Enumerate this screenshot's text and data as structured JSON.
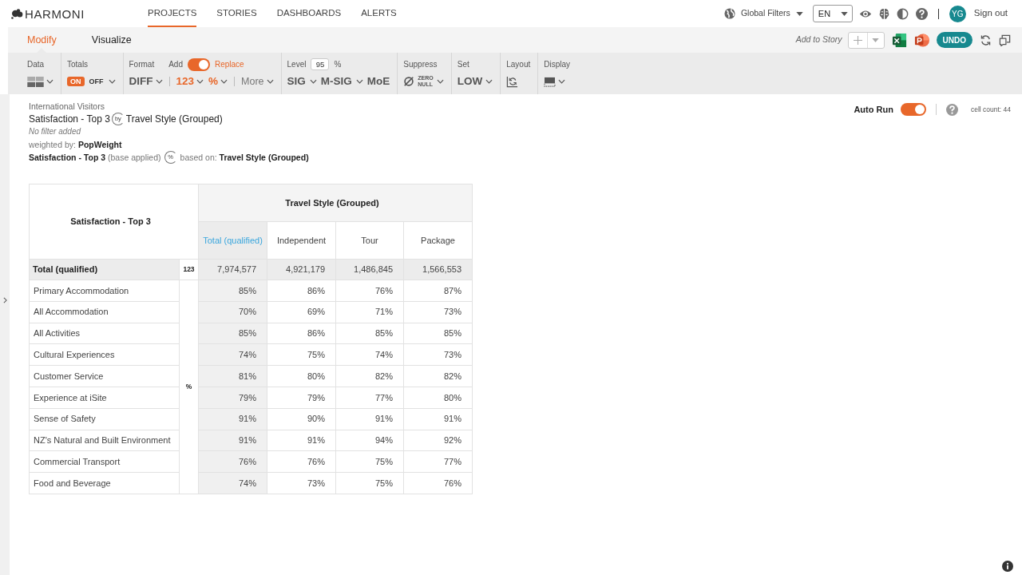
{
  "header": {
    "logo": "HARMONI",
    "nav": [
      {
        "label": "PROJECTS",
        "selected": true
      },
      {
        "label": "STORIES",
        "selected": false
      },
      {
        "label": "DASHBOARDS",
        "selected": false
      },
      {
        "label": "ALERTS",
        "selected": false
      }
    ],
    "global_filters": "Global Filters",
    "language": "EN",
    "avatar": "YG",
    "sign_out": "Sign out"
  },
  "subbar": {
    "tabs": [
      {
        "label": "Modify",
        "selected": true
      },
      {
        "label": "Visualize",
        "selected": false
      }
    ],
    "add_to_story": "Add to Story",
    "undo": "UNDO"
  },
  "toolbar": [
    {
      "kind": "data",
      "label": "Data"
    },
    {
      "kind": "totals",
      "label": "Totals",
      "options": [
        {
          "label": "ON",
          "selected": true
        },
        {
          "label": "OFF",
          "selected": false
        }
      ]
    },
    {
      "kind": "format",
      "label": "Format",
      "switch": {
        "off_label": "Add",
        "on_label": "Replace",
        "on": true
      },
      "sections": [
        [
          {
            "kind": "option",
            "label": "DIFF",
            "active": false
          }
        ],
        [
          {
            "kind": "option",
            "label": "123",
            "active": true
          },
          {
            "kind": "option",
            "label": "%",
            "active": true
          }
        ],
        [
          {
            "kind": "more",
            "label": "More",
            "active": false
          }
        ]
      ]
    },
    {
      "kind": "level",
      "label": "Level",
      "value": "95",
      "unit": "%",
      "items": [
        {
          "kind": "menu",
          "label": "SIG"
        },
        {
          "kind": "menu",
          "label": "M-SIG"
        },
        {
          "kind": "plain",
          "label": "MoE"
        }
      ]
    },
    {
      "kind": "suppress",
      "label": "Suppress",
      "lines": [
        "ZERO",
        "NULL"
      ]
    },
    {
      "kind": "set",
      "label": "Set",
      "value": "LOW"
    },
    {
      "kind": "layout",
      "label": "Layout"
    },
    {
      "kind": "display",
      "label": "Display"
    }
  ],
  "report": {
    "dataset": "International Visitors",
    "title": {
      "rows": "Satisfaction - Top 3",
      "symbol": "by",
      "columns": "Travel Style (Grouped)"
    },
    "filter": "No filter added",
    "weighting": "weighted by: **PopWeight**",
    "base": {
      "variable": "**Satisfaction - Top 3** (base applied)",
      "symbol": "%",
      "based_on": "based on: **Travel Style (Grouped)**"
    }
  },
  "auto_run": {
    "label": "Auto Run",
    "on": true
  },
  "cell_count": "cell count: 44",
  "table": {
    "corner": "Satisfaction - Top 3",
    "banner": "Travel Style (Grouped)",
    "columns": [
      {
        "label": "Total (qualified)",
        "kind": "total"
      },
      {
        "label": "Independent",
        "kind": "segment"
      },
      {
        "label": "Tour",
        "kind": "segment"
      },
      {
        "label": "Package",
        "kind": "segment"
      }
    ],
    "total_row": {
      "label": "Total (qualified)",
      "statistic": "123",
      "values": [
        "7,974,577",
        "4,921,179",
        "1,486,845",
        "1,566,553"
      ]
    },
    "statistic": "%",
    "rows": [
      {
        "label": "Primary Accommodation",
        "values": [
          "85%",
          "86%",
          "76%",
          "87%"
        ]
      },
      {
        "label": "All Accommodation",
        "values": [
          "70%",
          "69%",
          "71%",
          "73%"
        ]
      },
      {
        "label": "All Activities",
        "values": [
          "85%",
          "86%",
          "85%",
          "85%"
        ]
      },
      {
        "label": "Cultural Experiences",
        "values": [
          "74%",
          "75%",
          "74%",
          "73%"
        ]
      },
      {
        "label": "Customer Service",
        "values": [
          "81%",
          "80%",
          "82%",
          "82%"
        ]
      },
      {
        "label": "Experience at iSite",
        "values": [
          "79%",
          "79%",
          "77%",
          "80%"
        ]
      },
      {
        "label": "Sense of Safety",
        "values": [
          "91%",
          "90%",
          "91%",
          "91%"
        ]
      },
      {
        "label": "NZ's Natural and Built Environment",
        "values": [
          "91%",
          "91%",
          "94%",
          "92%"
        ]
      },
      {
        "label": "Commercial Transport",
        "values": [
          "76%",
          "76%",
          "75%",
          "77%"
        ]
      },
      {
        "label": "Food and Beverage",
        "values": [
          "74%",
          "73%",
          "75%",
          "76%"
        ]
      }
    ]
  }
}
